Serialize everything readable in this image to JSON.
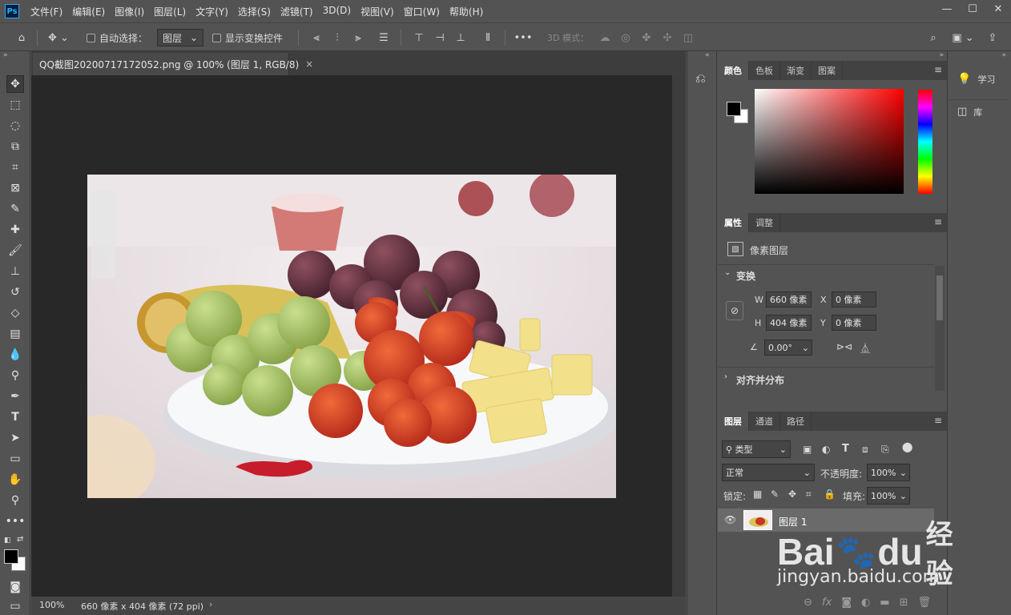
{
  "app": {
    "logo": "Ps"
  },
  "menu": [
    "文件(F)",
    "编辑(E)",
    "图像(I)",
    "图层(L)",
    "文字(Y)",
    "选择(S)",
    "滤镜(T)",
    "3D(D)",
    "视图(V)",
    "窗口(W)",
    "帮助(H)"
  ],
  "options": {
    "auto_select_label": "自动选择：",
    "auto_select_value": "图层",
    "show_transform_label": "显示变换控件",
    "mode_3d_label": "3D 模式："
  },
  "document": {
    "tab_title": "QQ截图20200717172052.png @ 100% (图层 1, RGB/8)",
    "close_glyph": "×"
  },
  "status": {
    "zoom": "100%",
    "info": "660 像素 x 404 像素 (72 ppi)",
    "arrow": "›"
  },
  "color_panel": {
    "tabs": [
      "颜色",
      "色板",
      "渐变",
      "图案"
    ]
  },
  "properties": {
    "tabs": [
      "属性",
      "调整"
    ],
    "layer_type": "像素图层",
    "transform_title": "变换",
    "w_label": "W",
    "w_value": "660 像素",
    "h_label": "H",
    "h_value": "404 像素",
    "x_label": "X",
    "x_value": "0 像素",
    "y_label": "Y",
    "y_value": "0 像素",
    "angle_value": "0.00°",
    "align_title": "对齐并分布"
  },
  "layers": {
    "tabs": [
      "图层",
      "通道",
      "路径"
    ],
    "filter_kind": "类型",
    "blend_mode": "正常",
    "opacity_label": "不透明度:",
    "opacity_value": "100%",
    "lock_label": "锁定:",
    "fill_label": "填充:",
    "fill_value": "100%",
    "layer_name": "图层 1"
  },
  "right_dock": {
    "learn": "学习",
    "library": "库"
  },
  "watermark": {
    "brand": "Bai",
    "brand2": "du",
    "cn": "经验",
    "url": "jingyan.baidu.com"
  },
  "colors": {
    "accent": "#31a8ff",
    "foreground": "#000000",
    "background": "#ffffff"
  }
}
